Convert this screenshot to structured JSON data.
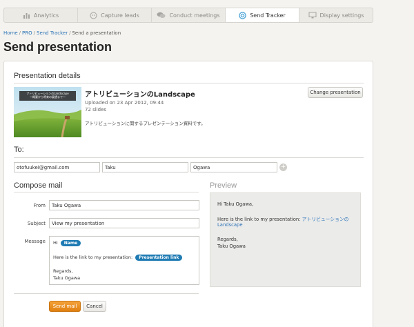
{
  "tabs": [
    {
      "label": "Analytics",
      "icon": "analytics-icon",
      "active": false
    },
    {
      "label": "Capture leads",
      "icon": "capture-leads-icon",
      "active": false
    },
    {
      "label": "Conduct meetings",
      "icon": "chat-bubbles-icon",
      "active": false
    },
    {
      "label": "Send Tracker",
      "icon": "target-icon",
      "active": true
    },
    {
      "label": "Display settings",
      "icon": "display-icon",
      "active": false
    }
  ],
  "breadcrumb": {
    "home": "Home",
    "pro": "PRO",
    "send_tracker": "Send Tracker",
    "current": "Send a presentation"
  },
  "page_title": "Send presentation",
  "presentation": {
    "section_title": "Presentation details",
    "title": "アトリビューションのLandscape",
    "uploaded": "Uploaded on 23 Apr 2012, 09:44",
    "slides": "72 slides",
    "description": "アトリビューションに関するプレゼンテーション資料です。",
    "change_button": "Change presentation",
    "thumb_caption_line1": "アトリビューションのLandscape",
    "thumb_caption_line2": "〜概要から将来の展望まで〜"
  },
  "to": {
    "section_title": "To:",
    "email": "otofuukei@gmail.com",
    "first_name": "Taku",
    "last_name": "Ogawa"
  },
  "compose": {
    "section_title": "Compose mail",
    "from_label": "From",
    "from_value": "Taku Ogawa",
    "subject_label": "Subject",
    "subject_value": "View my presentation",
    "message_label": "Message",
    "msg_hi": "Hi",
    "msg_name_tag": "Name",
    "msg_link_text": "Here is the link to my presentation:",
    "msg_link_tag": "Presentation link",
    "msg_regards": "Regards,",
    "msg_signature": "Taku Ogawa",
    "send_button": "Send mail",
    "cancel_button": "Cancel"
  },
  "preview": {
    "section_title": "Preview",
    "greeting": "Hi Taku Ogawa,",
    "link_text": "Here is the link to my presentation:",
    "link_title_part1": "アトリビューションの",
    "link_title_part2": "Landscape",
    "regards": "Regards,",
    "signature": "Taku Ogawa"
  },
  "colors": {
    "accent": "#e08a1a",
    "link": "#2a72b5",
    "pill": "#1f7bb3",
    "active_tab_icon": "#3a9bd3"
  }
}
